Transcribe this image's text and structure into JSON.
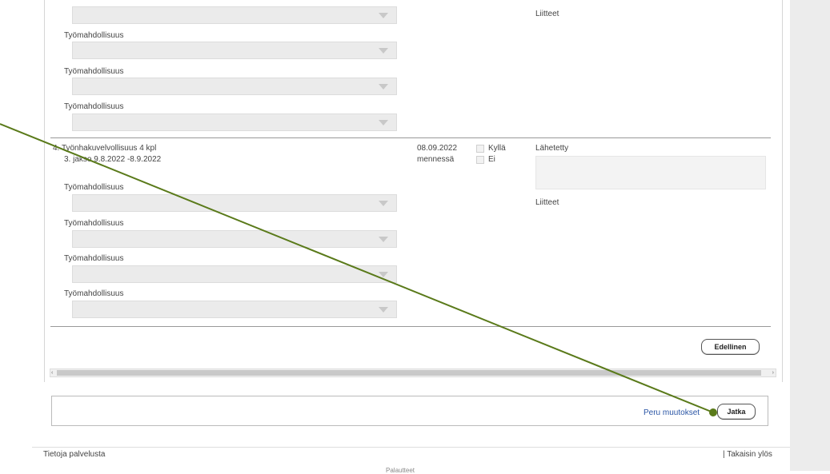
{
  "section_top": {
    "field_label": "Työmahdollisuus",
    "attachments_label": "Liitteet"
  },
  "job_item_4": {
    "title": "4. Työnhakuvelvollisuus 4 kpl",
    "period": "3. jakso 9.8.2022 -8.9.2022",
    "deadline_date": "08.09.2022",
    "deadline_suffix": "mennessä",
    "option_yes": "Kyllä",
    "option_no": "Ei",
    "sent_label": "Lähetetty",
    "field_label": "Työmahdollisuus",
    "attachments_label": "Liitteet"
  },
  "nav": {
    "previous_button": "Edellinen"
  },
  "actions": {
    "cancel_link": "Peru muutokset",
    "continue_button": "Jatka"
  },
  "footer": {
    "about_link": "Tietoja palvelusta",
    "back_to_top": "| Takaisin ylös",
    "partial_text": "Palautteet"
  },
  "colors": {
    "annotation_arrow": "#5a7a1a",
    "link": "#2a55a5"
  }
}
